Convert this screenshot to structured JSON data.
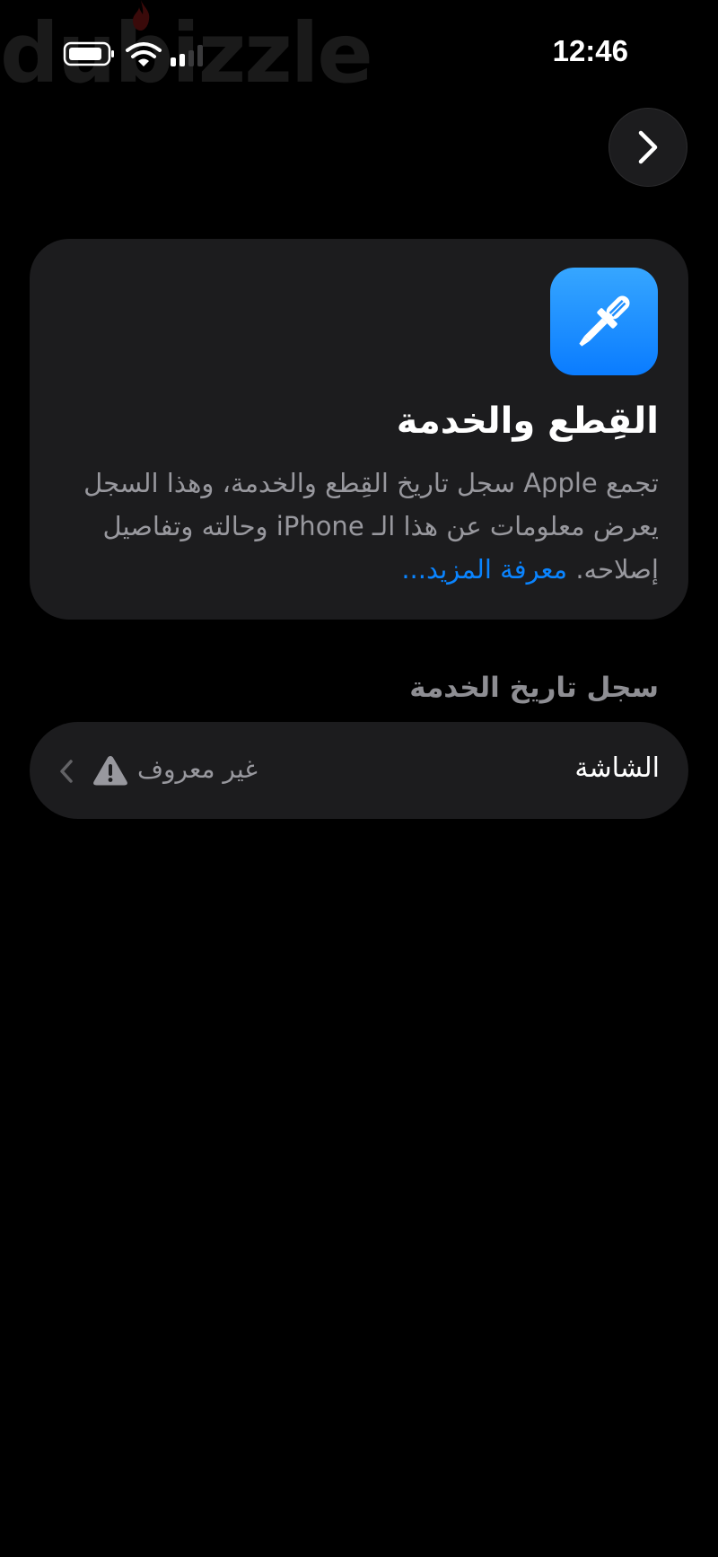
{
  "status_bar": {
    "time": "12:46",
    "watermark": "dubizzle"
  },
  "navigation": {
    "back_icon": "chevron-right-icon"
  },
  "info_card": {
    "icon": "screwdriver-icon",
    "icon_color": "#0a84ff",
    "title": "القِطع والخدمة",
    "description": "تجمع Apple سجل تاريخ القِطع والخدمة، وهذا السجل يعرض معلومات عن هذا الـ iPhone وحالته وتفاصيل إصلاحه.",
    "learn_more": "معرفة المزيد..."
  },
  "service_history": {
    "header": "سجل تاريخ الخدمة",
    "rows": [
      {
        "label": "الشاشة",
        "status": "غير معروف",
        "status_icon": "warning-icon"
      }
    ]
  },
  "colors": {
    "background": "#000000",
    "card": "#1c1c1e",
    "accent": "#0a84ff",
    "secondary_text": "#98989e"
  }
}
